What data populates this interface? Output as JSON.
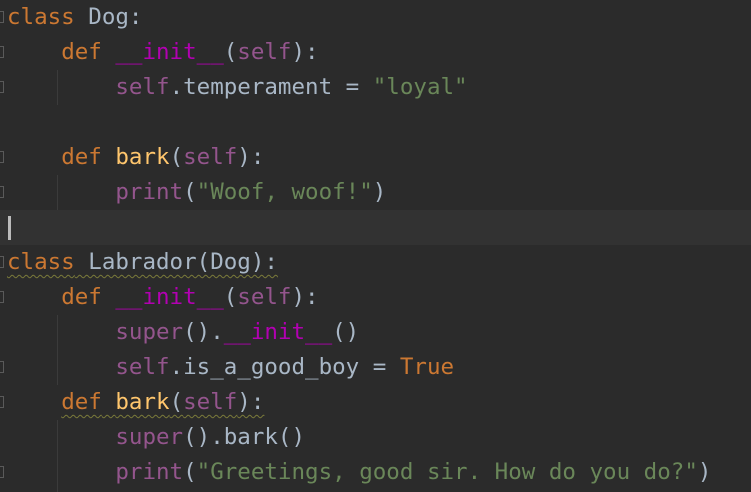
{
  "editor": {
    "lines": [
      {
        "tokens": [
          {
            "t": "class",
            "c": "kw"
          },
          {
            "t": " Dog:",
            "c": "plain"
          }
        ]
      },
      {
        "tokens": [
          {
            "t": "    ",
            "c": "plain"
          },
          {
            "t": "def",
            "c": "kw"
          },
          {
            "t": " ",
            "c": "plain"
          },
          {
            "t": "__init__",
            "c": "magic"
          },
          {
            "t": "(",
            "c": "plain"
          },
          {
            "t": "self",
            "c": "self"
          },
          {
            "t": "):",
            "c": "plain"
          }
        ]
      },
      {
        "tokens": [
          {
            "t": "        ",
            "c": "plain"
          },
          {
            "t": "self",
            "c": "self"
          },
          {
            "t": ".temperament = ",
            "c": "plain"
          },
          {
            "t": "\"loyal\"",
            "c": "str"
          }
        ]
      },
      {
        "tokens": []
      },
      {
        "tokens": [
          {
            "t": "    ",
            "c": "plain"
          },
          {
            "t": "def",
            "c": "kw"
          },
          {
            "t": " ",
            "c": "plain"
          },
          {
            "t": "bark",
            "c": "fn"
          },
          {
            "t": "(",
            "c": "plain"
          },
          {
            "t": "self",
            "c": "self"
          },
          {
            "t": "):",
            "c": "plain"
          }
        ]
      },
      {
        "tokens": [
          {
            "t": "        ",
            "c": "plain"
          },
          {
            "t": "print",
            "c": "self"
          },
          {
            "t": "(",
            "c": "plain"
          },
          {
            "t": "\"Woof, woof!\"",
            "c": "str"
          },
          {
            "t": ")",
            "c": "plain"
          }
        ]
      },
      {
        "tokens": []
      },
      {
        "tokens": [
          {
            "t": "class",
            "c": "kw",
            "w": true
          },
          {
            "t": " Labrador(Dog):",
            "c": "plain",
            "w": true
          }
        ]
      },
      {
        "tokens": [
          {
            "t": "    ",
            "c": "plain"
          },
          {
            "t": "def",
            "c": "kw"
          },
          {
            "t": " ",
            "c": "plain"
          },
          {
            "t": "__init__",
            "c": "magic"
          },
          {
            "t": "(",
            "c": "plain"
          },
          {
            "t": "self",
            "c": "self"
          },
          {
            "t": "):",
            "c": "plain"
          }
        ]
      },
      {
        "tokens": [
          {
            "t": "        ",
            "c": "plain"
          },
          {
            "t": "super",
            "c": "self"
          },
          {
            "t": "().",
            "c": "plain"
          },
          {
            "t": "__init__",
            "c": "magic"
          },
          {
            "t": "()",
            "c": "plain"
          }
        ]
      },
      {
        "tokens": [
          {
            "t": "        ",
            "c": "plain"
          },
          {
            "t": "self",
            "c": "self"
          },
          {
            "t": ".is_a_good_boy = ",
            "c": "plain"
          },
          {
            "t": "True",
            "c": "kw"
          }
        ]
      },
      {
        "tokens": [
          {
            "t": "    ",
            "c": "plain"
          },
          {
            "t": "def",
            "c": "kw",
            "w": true
          },
          {
            "t": " ",
            "c": "plain",
            "w": true
          },
          {
            "t": "bark",
            "c": "fn",
            "w": true
          },
          {
            "t": "(",
            "c": "plain",
            "w": true
          },
          {
            "t": "self",
            "c": "self",
            "w": true
          },
          {
            "t": "):",
            "c": "plain",
            "w": true
          }
        ]
      },
      {
        "tokens": [
          {
            "t": "        ",
            "c": "plain"
          },
          {
            "t": "super",
            "c": "self"
          },
          {
            "t": "().bark()",
            "c": "plain"
          }
        ]
      },
      {
        "tokens": [
          {
            "t": "        ",
            "c": "plain"
          },
          {
            "t": "print",
            "c": "self"
          },
          {
            "t": "(",
            "c": "plain"
          },
          {
            "t": "\"Greetings, good sir. How do you do?\"",
            "c": "str"
          },
          {
            "t": ")",
            "c": "plain"
          }
        ]
      }
    ],
    "current_line": 6,
    "colors": {
      "background": "#2b2b2b",
      "current_line": "#323232",
      "keyword": "#cc7832",
      "function": "#ffc66d",
      "self": "#94558d",
      "magic": "#b200b2",
      "string": "#6a8759",
      "text": "#a9b7c6"
    }
  }
}
